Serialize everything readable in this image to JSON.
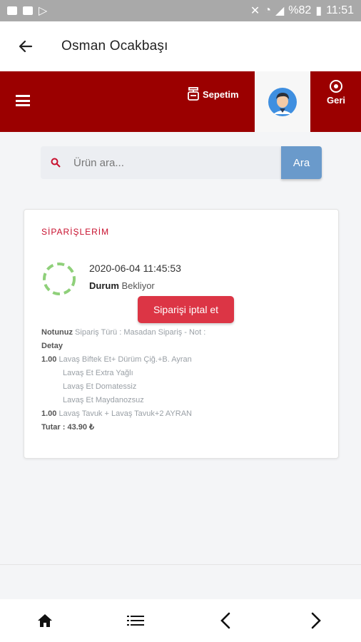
{
  "status_bar": {
    "battery_percent": "%82",
    "time": "11:51"
  },
  "app_bar": {
    "title": "Osman Ocakbaşı"
  },
  "red_bar": {
    "cart_label": "Sepetim",
    "back_label": "Geri"
  },
  "search": {
    "placeholder": "Ürün ara...",
    "button_label": "Ara"
  },
  "orders": {
    "title": "SİPARİŞLERİM",
    "date": "2020-06-04 11:45:53",
    "status_key": "Durum",
    "status_value": "Bekliyor",
    "cancel_label": "Siparişi iptal et",
    "note_key": "Notunuz",
    "note_value": "Sipariş Türü : Masadan Sipariş - Not :",
    "detail_key": "Detay",
    "items": [
      {
        "qty": "1.00",
        "name": "Lavaş Biftek Et+ Dürüm Çiğ.+B. Ayran"
      },
      {
        "sub": "Lavaş Et Extra Yağlı"
      },
      {
        "sub": "Lavaş Et Domatessiz"
      },
      {
        "sub": "Lavaş Et Maydanozsuz"
      },
      {
        "qty": "1.00",
        "name": "Lavaş Tavuk + Lavaş Tavuk+2 AYRAN"
      }
    ],
    "total": "Tutar : 43.90 ₺"
  },
  "colors": {
    "brand_red": "#9b0000",
    "search_button": "#6a9acb",
    "cancel_button": "#dc3545",
    "spinner": "#8fd07a"
  }
}
